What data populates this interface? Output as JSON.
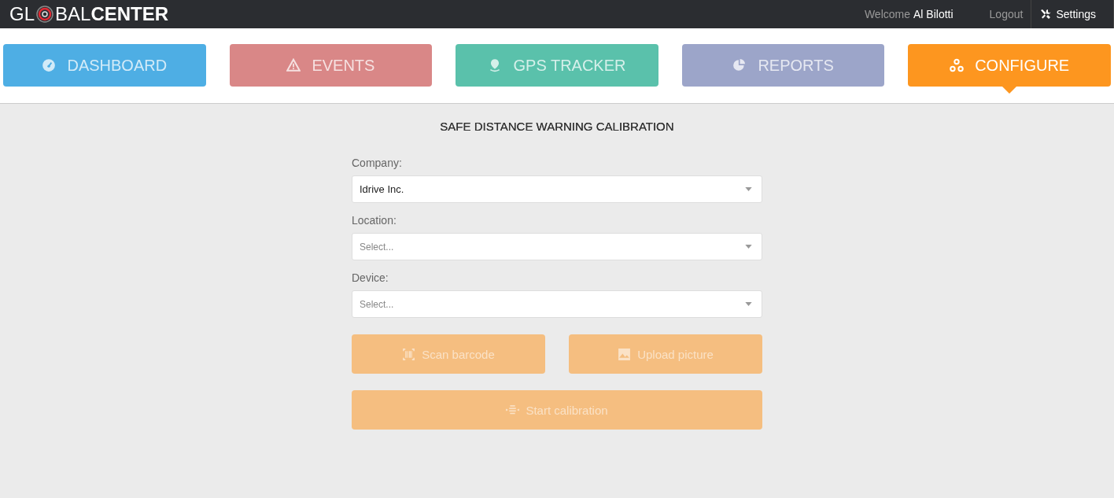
{
  "header": {
    "logo": {
      "start": "GL",
      "middle": "BAL",
      "bold": "CENTER"
    },
    "welcome": "Welcome",
    "user": "Al Bilotti",
    "logout": "Logout",
    "settings": "Settings"
  },
  "tabs": [
    {
      "label": "DASHBOARD",
      "kind": "gauge",
      "color": "#4eaee4",
      "selected": false
    },
    {
      "label": "EVENTS",
      "kind": "warning",
      "color": "#d98787",
      "selected": false
    },
    {
      "label": "GPS TRACKER",
      "kind": "pin",
      "color": "#5ac1ab",
      "selected": false
    },
    {
      "label": "REPORTS",
      "kind": "pie",
      "color": "#9ca5c9",
      "selected": false
    },
    {
      "label": "CONFIGURE",
      "kind": "nodes",
      "color": "#fd961f",
      "selected": true
    }
  ],
  "form": {
    "title": "SAFE DISTANCE WARNING CALIBRATION",
    "fields": [
      {
        "label": "Company:",
        "value": "Idrive Inc."
      },
      {
        "label": "Location:",
        "placeholder": "Select..."
      },
      {
        "label": "Device:",
        "placeholder": "Select..."
      }
    ],
    "buttons": [
      {
        "label": "Scan barcode",
        "kind": "barcode",
        "disabled": true
      },
      {
        "label": "Upload picture",
        "kind": "image",
        "disabled": true
      }
    ],
    "main_button": {
      "label": "Start calibration",
      "kind": "align",
      "disabled": true
    }
  }
}
